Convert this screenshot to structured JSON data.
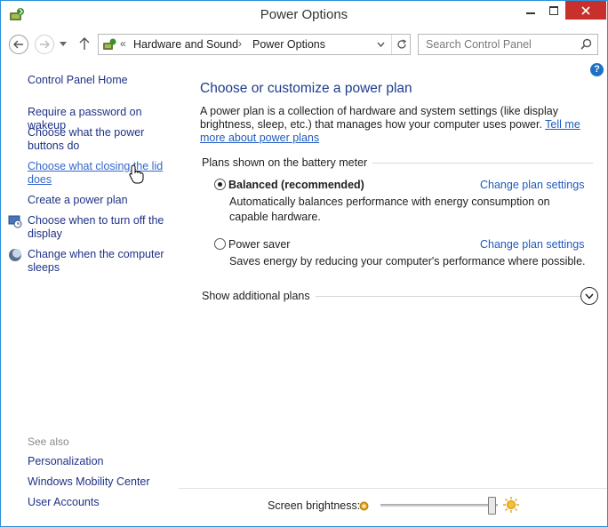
{
  "window": {
    "title": "Power Options"
  },
  "address": {
    "crumb_sep": "«",
    "crumb1": "Hardware and Sound",
    "arrow": "›",
    "crumb2": "Power Options"
  },
  "search": {
    "placeholder": "Search Control Panel"
  },
  "help": {
    "label": "?"
  },
  "sidebar": {
    "items": [
      {
        "label": "Control Panel Home"
      },
      {
        "label": "Require a password on wakeup"
      },
      {
        "label": "Choose what the power buttons do"
      },
      {
        "label": "Choose what closing the lid does"
      },
      {
        "label": "Create a power plan"
      },
      {
        "label": "Choose when to turn off the display"
      },
      {
        "label": "Change when the computer sleeps"
      }
    ],
    "see_also_label": "See also",
    "see_also": [
      {
        "label": "Personalization"
      },
      {
        "label": "Windows Mobility Center"
      },
      {
        "label": "User Accounts"
      }
    ]
  },
  "main": {
    "heading": "Choose or customize a power plan",
    "intro": "A power plan is a collection of hardware and system settings (like display brightness, sleep, etc.) that manages how your computer uses power. ",
    "intro_link": "Tell me more about power plans",
    "group_label": "Plans shown on the battery meter",
    "plans": [
      {
        "name": "Balanced (recommended)",
        "selected": true,
        "desc": "Automatically balances performance with energy consumption on capable hardware.",
        "change_label": "Change plan settings"
      },
      {
        "name": "Power saver",
        "selected": false,
        "desc": "Saves energy by reducing your computer's performance where possible.",
        "change_label": "Change plan settings"
      }
    ],
    "additional_label": "Show additional plans"
  },
  "brightness": {
    "label": "Screen brightness:",
    "value_fraction": 0.95
  },
  "colors": {
    "accent": "#2b8fd9",
    "link": "#1e5bbf",
    "heading": "#1e3c8c",
    "close": "#c7302b"
  }
}
